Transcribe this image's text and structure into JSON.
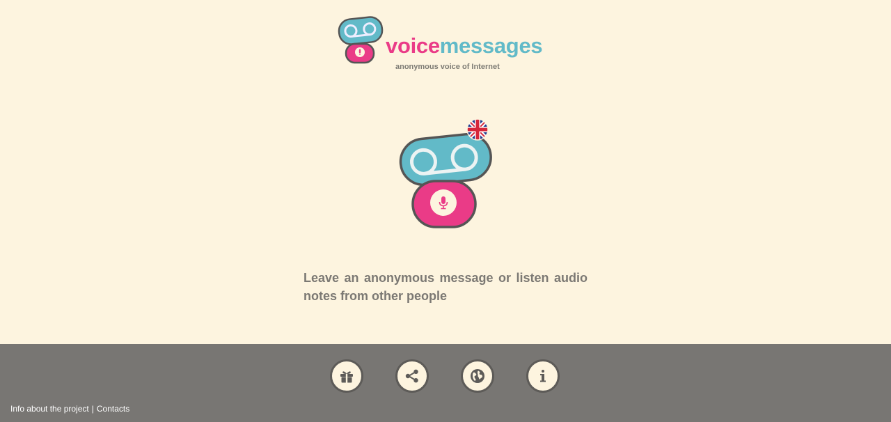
{
  "header": {
    "brand_part1": "voice",
    "brand_part2": "messages",
    "tagline": "anonymous voice of Internet"
  },
  "main": {
    "record_icon": "microphone-icon",
    "language_icon": "uk-flag-icon",
    "description": "Leave an anonymous message or listen audio notes from other people"
  },
  "footer": {
    "buttons": [
      {
        "icon": "gift-icon"
      },
      {
        "icon": "share-icon"
      },
      {
        "icon": "globe-icon"
      },
      {
        "icon": "info-icon"
      }
    ],
    "link_info": "Info about the project",
    "separator": "|",
    "link_contacts": "Contacts"
  },
  "colors": {
    "background": "#fdf4df",
    "pink": "#ea3b87",
    "teal": "#62bac8",
    "footer": "#787673",
    "text": "#7b7873"
  }
}
